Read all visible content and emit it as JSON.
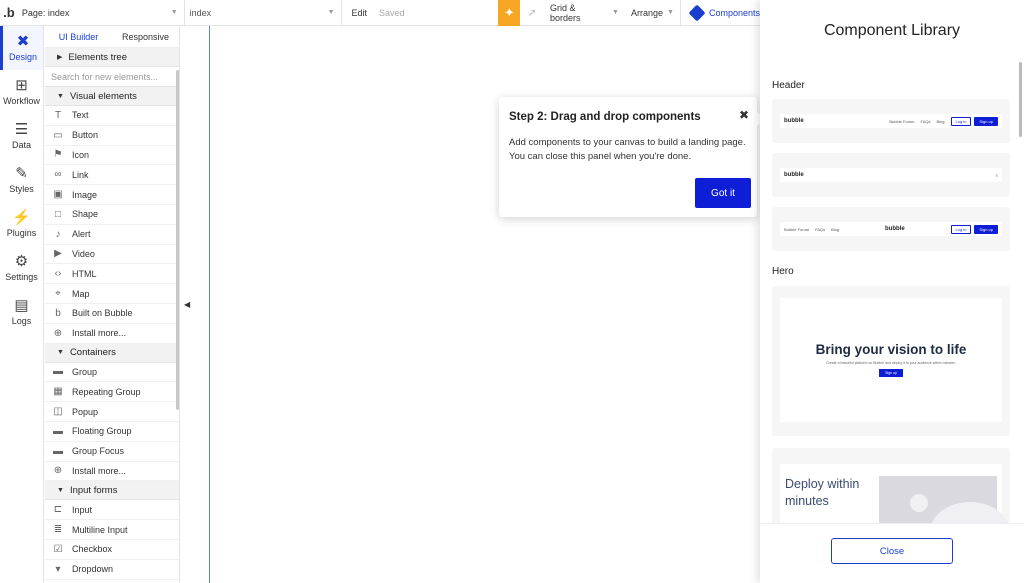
{
  "topbar": {
    "logo": ".b",
    "page_label": "Page: index",
    "index_label": "index",
    "edit_label": "Edit",
    "saved_label": "Saved",
    "grid_label": "Grid & borders",
    "arrange_label": "Arrange",
    "components_label": "Components"
  },
  "leftnav": [
    {
      "label": "Design",
      "icon": "design-icon"
    },
    {
      "label": "Workflow",
      "icon": "workflow-icon"
    },
    {
      "label": "Data",
      "icon": "data-icon"
    },
    {
      "label": "Styles",
      "icon": "styles-icon"
    },
    {
      "label": "Plugins",
      "icon": "plugins-icon"
    },
    {
      "label": "Settings",
      "icon": "settings-icon"
    },
    {
      "label": "Logs",
      "icon": "logs-icon"
    }
  ],
  "panel": {
    "tab_ui_builder": "UI Builder",
    "tab_responsive": "Responsive",
    "elements_tree": "Elements tree",
    "search_placeholder": "Search for new elements...",
    "visual_elements_header": "Visual elements",
    "visual_elements": [
      "Text",
      "Button",
      "Icon",
      "Link",
      "Image",
      "Shape",
      "Alert",
      "Video",
      "HTML",
      "Map",
      "Built on Bubble",
      "Install more..."
    ],
    "containers_header": "Containers",
    "containers": [
      "Group",
      "Repeating Group",
      "Popup",
      "Floating Group",
      "Group Focus",
      "Install more..."
    ],
    "input_forms_header": "Input forms",
    "input_forms": [
      "Input",
      "Multiline Input",
      "Checkbox",
      "Dropdown"
    ]
  },
  "popup": {
    "title": "Step 2: Drag and drop components",
    "body": "Add components to your canvas to build a landing page. You can close this panel when you're done.",
    "button": "Got it"
  },
  "library": {
    "title": "Component Library",
    "header_group": "Header",
    "hero_group": "Hero",
    "bubble_brand": "bubble",
    "nav_forum": "Bubble Forum",
    "nav_faqs": "FAQs",
    "nav_blog": "Blog",
    "login": "Log in",
    "signup": "Sign up",
    "hero_title": "Bring your vision to life",
    "hero_sub": "Create a beautiful platform on Bubble and deploy it to your audience within minutes.",
    "hero_button": "Sign up",
    "deploy_title": "Deploy within minutes",
    "close_button": "Close"
  }
}
